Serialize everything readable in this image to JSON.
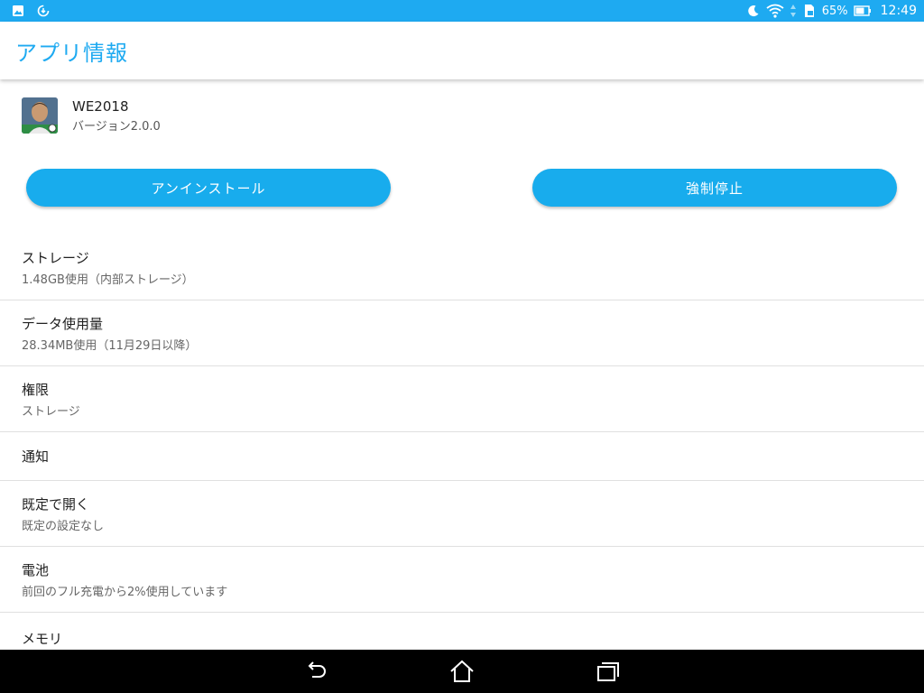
{
  "status_bar": {
    "left_icons": [
      "image-notification-icon",
      "download-notification-icon"
    ],
    "right_icons": [
      "do-not-disturb-moon-icon",
      "wifi-icon",
      "sim-card-icon",
      "battery-icon"
    ],
    "battery_percent": "65%",
    "time": "12:49",
    "color": "#1eaaf1"
  },
  "header": {
    "title": "アプリ情報",
    "title_color": "#1eaaf1"
  },
  "app": {
    "name": "WE2018",
    "version": "バージョン2.0.0",
    "icon": "app-icon-we2018"
  },
  "buttons": {
    "uninstall_label": "アンインストール",
    "force_stop_label": "強制停止",
    "color": "#18aced"
  },
  "settings": {
    "storage": {
      "title": "ストレージ",
      "subtitle": "1.48GB使用（内部ストレージ）"
    },
    "data_usage": {
      "title": "データ使用量",
      "subtitle": "28.34MB使用（11月29日以降）"
    },
    "permissions": {
      "title": "権限",
      "subtitle": "ストレージ"
    },
    "notifications": {
      "title": "通知"
    },
    "open_by_default": {
      "title": "既定で開く",
      "subtitle": "既定の設定なし"
    },
    "battery": {
      "title": "電池",
      "subtitle": "前回のフル充電から2%使用しています"
    },
    "memory": {
      "title": "メモリ"
    }
  },
  "nav_bar": {
    "icons": [
      "back-icon",
      "home-icon",
      "recent-apps-icon"
    ]
  }
}
